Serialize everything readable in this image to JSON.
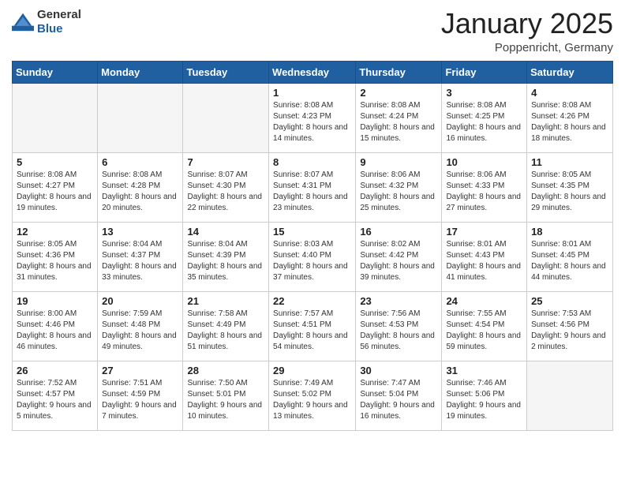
{
  "header": {
    "logo_general": "General",
    "logo_blue": "Blue",
    "month_title": "January 2025",
    "location": "Poppenricht, Germany"
  },
  "weekdays": [
    "Sunday",
    "Monday",
    "Tuesday",
    "Wednesday",
    "Thursday",
    "Friday",
    "Saturday"
  ],
  "weeks": [
    [
      {
        "day": "",
        "sunrise": "",
        "sunset": "",
        "daylight": ""
      },
      {
        "day": "",
        "sunrise": "",
        "sunset": "",
        "daylight": ""
      },
      {
        "day": "",
        "sunrise": "",
        "sunset": "",
        "daylight": ""
      },
      {
        "day": "1",
        "sunrise": "Sunrise: 8:08 AM",
        "sunset": "Sunset: 4:23 PM",
        "daylight": "Daylight: 8 hours and 14 minutes."
      },
      {
        "day": "2",
        "sunrise": "Sunrise: 8:08 AM",
        "sunset": "Sunset: 4:24 PM",
        "daylight": "Daylight: 8 hours and 15 minutes."
      },
      {
        "day": "3",
        "sunrise": "Sunrise: 8:08 AM",
        "sunset": "Sunset: 4:25 PM",
        "daylight": "Daylight: 8 hours and 16 minutes."
      },
      {
        "day": "4",
        "sunrise": "Sunrise: 8:08 AM",
        "sunset": "Sunset: 4:26 PM",
        "daylight": "Daylight: 8 hours and 18 minutes."
      }
    ],
    [
      {
        "day": "5",
        "sunrise": "Sunrise: 8:08 AM",
        "sunset": "Sunset: 4:27 PM",
        "daylight": "Daylight: 8 hours and 19 minutes."
      },
      {
        "day": "6",
        "sunrise": "Sunrise: 8:08 AM",
        "sunset": "Sunset: 4:28 PM",
        "daylight": "Daylight: 8 hours and 20 minutes."
      },
      {
        "day": "7",
        "sunrise": "Sunrise: 8:07 AM",
        "sunset": "Sunset: 4:30 PM",
        "daylight": "Daylight: 8 hours and 22 minutes."
      },
      {
        "day": "8",
        "sunrise": "Sunrise: 8:07 AM",
        "sunset": "Sunset: 4:31 PM",
        "daylight": "Daylight: 8 hours and 23 minutes."
      },
      {
        "day": "9",
        "sunrise": "Sunrise: 8:06 AM",
        "sunset": "Sunset: 4:32 PM",
        "daylight": "Daylight: 8 hours and 25 minutes."
      },
      {
        "day": "10",
        "sunrise": "Sunrise: 8:06 AM",
        "sunset": "Sunset: 4:33 PM",
        "daylight": "Daylight: 8 hours and 27 minutes."
      },
      {
        "day": "11",
        "sunrise": "Sunrise: 8:05 AM",
        "sunset": "Sunset: 4:35 PM",
        "daylight": "Daylight: 8 hours and 29 minutes."
      }
    ],
    [
      {
        "day": "12",
        "sunrise": "Sunrise: 8:05 AM",
        "sunset": "Sunset: 4:36 PM",
        "daylight": "Daylight: 8 hours and 31 minutes."
      },
      {
        "day": "13",
        "sunrise": "Sunrise: 8:04 AM",
        "sunset": "Sunset: 4:37 PM",
        "daylight": "Daylight: 8 hours and 33 minutes."
      },
      {
        "day": "14",
        "sunrise": "Sunrise: 8:04 AM",
        "sunset": "Sunset: 4:39 PM",
        "daylight": "Daylight: 8 hours and 35 minutes."
      },
      {
        "day": "15",
        "sunrise": "Sunrise: 8:03 AM",
        "sunset": "Sunset: 4:40 PM",
        "daylight": "Daylight: 8 hours and 37 minutes."
      },
      {
        "day": "16",
        "sunrise": "Sunrise: 8:02 AM",
        "sunset": "Sunset: 4:42 PM",
        "daylight": "Daylight: 8 hours and 39 minutes."
      },
      {
        "day": "17",
        "sunrise": "Sunrise: 8:01 AM",
        "sunset": "Sunset: 4:43 PM",
        "daylight": "Daylight: 8 hours and 41 minutes."
      },
      {
        "day": "18",
        "sunrise": "Sunrise: 8:01 AM",
        "sunset": "Sunset: 4:45 PM",
        "daylight": "Daylight: 8 hours and 44 minutes."
      }
    ],
    [
      {
        "day": "19",
        "sunrise": "Sunrise: 8:00 AM",
        "sunset": "Sunset: 4:46 PM",
        "daylight": "Daylight: 8 hours and 46 minutes."
      },
      {
        "day": "20",
        "sunrise": "Sunrise: 7:59 AM",
        "sunset": "Sunset: 4:48 PM",
        "daylight": "Daylight: 8 hours and 49 minutes."
      },
      {
        "day": "21",
        "sunrise": "Sunrise: 7:58 AM",
        "sunset": "Sunset: 4:49 PM",
        "daylight": "Daylight: 8 hours and 51 minutes."
      },
      {
        "day": "22",
        "sunrise": "Sunrise: 7:57 AM",
        "sunset": "Sunset: 4:51 PM",
        "daylight": "Daylight: 8 hours and 54 minutes."
      },
      {
        "day": "23",
        "sunrise": "Sunrise: 7:56 AM",
        "sunset": "Sunset: 4:53 PM",
        "daylight": "Daylight: 8 hours and 56 minutes."
      },
      {
        "day": "24",
        "sunrise": "Sunrise: 7:55 AM",
        "sunset": "Sunset: 4:54 PM",
        "daylight": "Daylight: 8 hours and 59 minutes."
      },
      {
        "day": "25",
        "sunrise": "Sunrise: 7:53 AM",
        "sunset": "Sunset: 4:56 PM",
        "daylight": "Daylight: 9 hours and 2 minutes."
      }
    ],
    [
      {
        "day": "26",
        "sunrise": "Sunrise: 7:52 AM",
        "sunset": "Sunset: 4:57 PM",
        "daylight": "Daylight: 9 hours and 5 minutes."
      },
      {
        "day": "27",
        "sunrise": "Sunrise: 7:51 AM",
        "sunset": "Sunset: 4:59 PM",
        "daylight": "Daylight: 9 hours and 7 minutes."
      },
      {
        "day": "28",
        "sunrise": "Sunrise: 7:50 AM",
        "sunset": "Sunset: 5:01 PM",
        "daylight": "Daylight: 9 hours and 10 minutes."
      },
      {
        "day": "29",
        "sunrise": "Sunrise: 7:49 AM",
        "sunset": "Sunset: 5:02 PM",
        "daylight": "Daylight: 9 hours and 13 minutes."
      },
      {
        "day": "30",
        "sunrise": "Sunrise: 7:47 AM",
        "sunset": "Sunset: 5:04 PM",
        "daylight": "Daylight: 9 hours and 16 minutes."
      },
      {
        "day": "31",
        "sunrise": "Sunrise: 7:46 AM",
        "sunset": "Sunset: 5:06 PM",
        "daylight": "Daylight: 9 hours and 19 minutes."
      },
      {
        "day": "",
        "sunrise": "",
        "sunset": "",
        "daylight": ""
      }
    ]
  ]
}
